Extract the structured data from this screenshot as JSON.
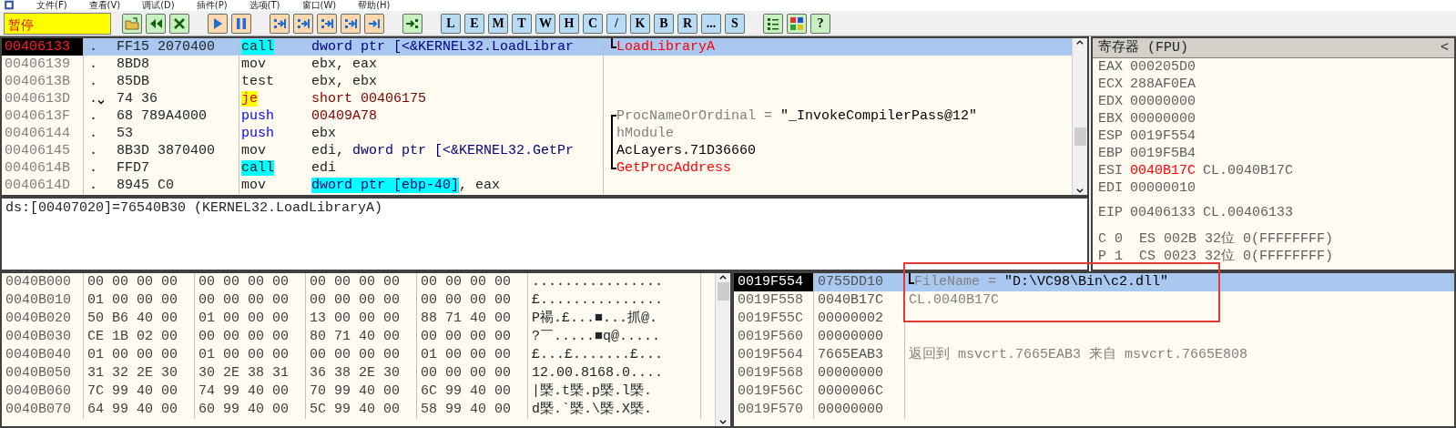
{
  "menu": [
    "文件(F)",
    "查看(V)",
    "调试(D)",
    "插件(P)",
    "选项(T)",
    "窗口(W)",
    "帮助(H)"
  ],
  "toolbar": {
    "status": "暂停",
    "window_buttons": [
      "L",
      "E",
      "M",
      "T",
      "W",
      "H",
      "C",
      "/",
      "K",
      "B",
      "R",
      "...",
      "S"
    ],
    "help_button": "?"
  },
  "disassembly": {
    "rows": [
      {
        "kind": "call",
        "address": "00406133",
        "current": true,
        "selected": true,
        "marker": ".",
        "jump_arrow": false,
        "hex": "FF15 2070400",
        "mnemonic": "call",
        "operand": [
          {
            "text": "dword ptr [<&KERNEL32.LoadLibrar",
            "kind": "memory"
          }
        ],
        "comment": [
          {
            "text": "LoadLibraryA",
            "kind": "api"
          }
        ],
        "bracket_line": true,
        "bracket_top": false,
        "bracket_bottom": true
      },
      {
        "kind": "plain",
        "address": "00406139",
        "current": false,
        "selected": false,
        "marker": ".",
        "jump_arrow": false,
        "hex": "8BD8",
        "mnemonic": "mov",
        "operand": [
          {
            "text": "ebx, eax",
            "kind": "plain"
          }
        ],
        "comment": [],
        "bracket_line": false
      },
      {
        "kind": "plain",
        "address": "0040613B",
        "current": false,
        "selected": false,
        "marker": ".",
        "jump_arrow": false,
        "hex": "85DB",
        "mnemonic": "test",
        "operand": [
          {
            "text": "ebx, ebx",
            "kind": "plain"
          }
        ],
        "comment": [],
        "bracket_line": false
      },
      {
        "kind": "jump",
        "address": "0040613D",
        "current": false,
        "selected": false,
        "marker": ".",
        "jump_arrow": true,
        "hex": "74 36",
        "mnemonic": "je",
        "operand": [
          {
            "text": "short 00406175",
            "kind": "constant"
          }
        ],
        "comment": [],
        "bracket_line": false
      },
      {
        "kind": "push",
        "address": "0040613F",
        "current": false,
        "selected": false,
        "marker": ".",
        "jump_arrow": false,
        "hex": "68 789A4000",
        "mnemonic": "push",
        "operand": [
          {
            "text": "00409A78",
            "kind": "constant"
          }
        ],
        "comment": [
          {
            "text": "ProcNameOrOrdinal = ",
            "kind": "label"
          },
          {
            "text": "\"_InvokeCompilerPass@12\"",
            "kind": "value"
          }
        ],
        "bracket_line": true,
        "bracket_top": true,
        "bracket_bottom": false
      },
      {
        "kind": "push",
        "address": "00406144",
        "current": false,
        "selected": false,
        "marker": ".",
        "jump_arrow": false,
        "hex": "53",
        "mnemonic": "push",
        "operand": [
          {
            "text": "ebx",
            "kind": "plain"
          }
        ],
        "comment": [
          {
            "text": "hModule",
            "kind": "label"
          }
        ],
        "bracket_line": true,
        "bracket_top": false,
        "bracket_bottom": false
      },
      {
        "kind": "plain",
        "address": "00406145",
        "current": false,
        "selected": false,
        "marker": ".",
        "jump_arrow": false,
        "hex": "8B3D 3870400",
        "mnemonic": "mov",
        "operand": [
          {
            "text": "edi, ",
            "kind": "plain"
          },
          {
            "text": "dword ptr [<&KERNEL32.GetPr",
            "kind": "memory"
          }
        ],
        "comment": [
          {
            "text": "AcLayers.71D36660",
            "kind": "value"
          }
        ],
        "bracket_line": true,
        "bracket_top": false,
        "bracket_bottom": false
      },
      {
        "kind": "call",
        "address": "0040614B",
        "current": false,
        "selected": false,
        "marker": ".",
        "jump_arrow": false,
        "hex": "FFD7",
        "mnemonic": "call",
        "operand": [
          {
            "text": "edi",
            "kind": "plain"
          }
        ],
        "comment": [
          {
            "text": "GetProcAddress",
            "kind": "api"
          }
        ],
        "bracket_line": true,
        "bracket_top": false,
        "bracket_bottom": true
      },
      {
        "kind": "plain",
        "address": "0040614D",
        "current": false,
        "selected": false,
        "marker": ".",
        "jump_arrow": false,
        "hex": "8945 C0",
        "mnemonic": "mov",
        "operand": [
          {
            "text": "dword ptr [ebp-40]",
            "kind": "memory_highlight"
          },
          {
            "text": ", eax",
            "kind": "plain"
          }
        ],
        "comment": [],
        "bracket_line": false
      }
    ]
  },
  "info": "ds:[00407020]=76540B30 (KERNEL32.LoadLibraryA)",
  "registers": {
    "title": "寄存器 (FPU)",
    "collapse_button": "<",
    "general": [
      {
        "name": "EAX",
        "value": "000205D0",
        "changed": false
      },
      {
        "name": "ECX",
        "value": "288AF0EA",
        "changed": false
      },
      {
        "name": "EDX",
        "value": "00000000",
        "changed": false
      },
      {
        "name": "EBX",
        "value": "00000000",
        "changed": false
      },
      {
        "name": "ESP",
        "value": "0019F554",
        "changed": false
      },
      {
        "name": "EBP",
        "value": "0019F5B4",
        "changed": false
      },
      {
        "name": "ESI",
        "value": "0040B17C",
        "changed": true,
        "comment": "CL.0040B17C"
      },
      {
        "name": "EDI",
        "value": "00000010",
        "changed": false
      }
    ],
    "eip": {
      "name": "EIP",
      "value": "00406133",
      "comment": "CL.00406133"
    },
    "flags": [
      {
        "flag": "C",
        "flag_value": "0",
        "segment": "ES",
        "segment_value": "002B",
        "bits": "32位",
        "limit": "0(FFFFFFFF)"
      },
      {
        "flag": "P",
        "flag_value": "1",
        "segment": "CS",
        "segment_value": "0023",
        "bits": "32位",
        "limit": "0(FFFFFFFF)"
      }
    ]
  },
  "dump": {
    "rows": [
      {
        "address": "0040B000",
        "bytes": [
          "00 00 00 00",
          "00 00 00 00",
          "00 00 00 00",
          "00 00 00 00"
        ],
        "ascii": "................"
      },
      {
        "address": "0040B010",
        "bytes": [
          "01 00 00 00",
          "00 00 00 00",
          "00 00 00 00",
          "00 00 00 00"
        ],
        "ascii": "£..............."
      },
      {
        "address": "0040B020",
        "bytes": [
          "50 B6 40 00",
          "01 00 00 00",
          "13 00 00 00",
          "88 71 40 00"
        ],
        "ascii": "P禓.£...■...抓@."
      },
      {
        "address": "0040B030",
        "bytes": [
          "CE 1B 02 00",
          "00 00 00 00",
          "80 71 40 00",
          "00 00 00 00"
        ],
        "ascii": "?￣.....■q@....."
      },
      {
        "address": "0040B040",
        "bytes": [
          "01 00 00 00",
          "01 00 00 00",
          "00 00 00 00",
          "01 00 00 00"
        ],
        "ascii": "£...£.......£..."
      },
      {
        "address": "0040B050",
        "bytes": [
          "31 32 2E 30",
          "30 2E 38 31",
          "36 38 2E 30",
          "00 00 00 00"
        ],
        "ascii": "12.00.8168.0...."
      },
      {
        "address": "0040B060",
        "bytes": [
          "7C 99 40 00",
          "74 99 40 00",
          "70 99 40 00",
          "6C 99 40 00"
        ],
        "ascii": "|槩.t槩.p槩.l槩."
      },
      {
        "address": "0040B070",
        "bytes": [
          "64 99 40 00",
          "60 99 40 00",
          "5C 99 40 00",
          "58 99 40 00"
        ],
        "ascii": "d槩.`槩.\\槩.X槩."
      }
    ]
  },
  "stack": {
    "highlight_box": true,
    "rows": [
      {
        "address": "0019F554",
        "value": "0755DD10",
        "current": true,
        "selected": true,
        "comment": [
          {
            "text": "FileName = ",
            "kind": "label"
          },
          {
            "text": "\"D:\\VC98\\Bin\\c2.dll\"",
            "kind": "value"
          }
        ],
        "bracket_line": true,
        "bracket_top": false,
        "bracket_bottom": true
      },
      {
        "address": "0019F558",
        "value": "0040B17C",
        "current": false,
        "selected": false,
        "comment": [
          {
            "text": "CL.0040B17C",
            "kind": "label"
          }
        ],
        "bracket_line": false
      },
      {
        "address": "0019F55C",
        "value": "00000002",
        "current": false,
        "selected": false,
        "comment": [],
        "bracket_line": false
      },
      {
        "address": "0019F560",
        "value": "00000000",
        "current": false,
        "selected": false,
        "comment": [],
        "bracket_line": false
      },
      {
        "address": "0019F564",
        "value": "7665EAB3",
        "current": false,
        "selected": false,
        "comment": [
          {
            "text": "返回到 msvcrt.7665EAB3 来自 msvcrt.7665E808",
            "kind": "label"
          }
        ],
        "bracket_line": false
      },
      {
        "address": "0019F568",
        "value": "00000000",
        "current": false,
        "selected": false,
        "comment": [],
        "bracket_line": false
      },
      {
        "address": "0019F56C",
        "value": "0000006C",
        "current": false,
        "selected": false,
        "comment": [],
        "bracket_line": false
      },
      {
        "address": "0019F570",
        "value": "00000000",
        "current": false,
        "selected": false,
        "comment": [],
        "bracket_line": false
      }
    ]
  }
}
